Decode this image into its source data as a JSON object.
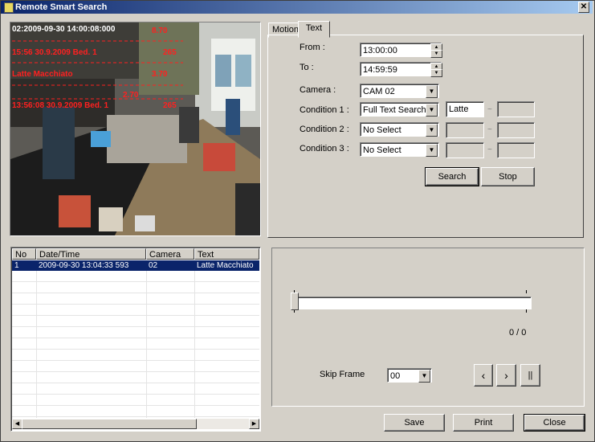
{
  "window": {
    "title": "Remote Smart Search",
    "close_glyph": "✕"
  },
  "tabs": [
    {
      "label": "Motion"
    },
    {
      "label": "Text"
    }
  ],
  "active_tab": "Text",
  "video": {
    "overlay_lines": [
      "02:2009-09-30 14:00:08:000",
      "8.70",
      "15:56 30.9.2009 Bed. 1",
      "265",
      "Latte Macchiato",
      "3.70",
      "2.70",
      "13:56:08 30.9.2009 Bed. 1",
      "265"
    ]
  },
  "form": {
    "from_label": "From :",
    "from_value": "13:00:00",
    "to_label": "To :",
    "to_value": "14:59:59",
    "camera_label": "Camera :",
    "camera_value": "CAM 02",
    "condition1_label": "Condition 1 :",
    "condition1_value": "Full Text Search",
    "condition1_text": "Latte",
    "condition2_label": "Condition 2 :",
    "condition2_value": "No Select",
    "condition3_label": "Condition 3 :",
    "condition3_value": "No Select",
    "range_sep": "~",
    "search_label": "Search",
    "stop_label": "Stop"
  },
  "results": {
    "columns": [
      "No",
      "Date/Time",
      "Camera",
      "Text"
    ],
    "rows": [
      {
        "no": "1",
        "datetime": "2009-09-30 13:04:33 593",
        "camera": "02",
        "text": "Latte Macchiato"
      }
    ]
  },
  "playback": {
    "position": 0,
    "counter": "0 / 0",
    "skip_frame_label": "Skip Frame",
    "skip_frame_value": "00",
    "prev_label": "‹",
    "next_label": "›",
    "pause_label": "||"
  },
  "footer": {
    "save_label": "Save",
    "print_label": "Print",
    "close_label": "Close"
  }
}
